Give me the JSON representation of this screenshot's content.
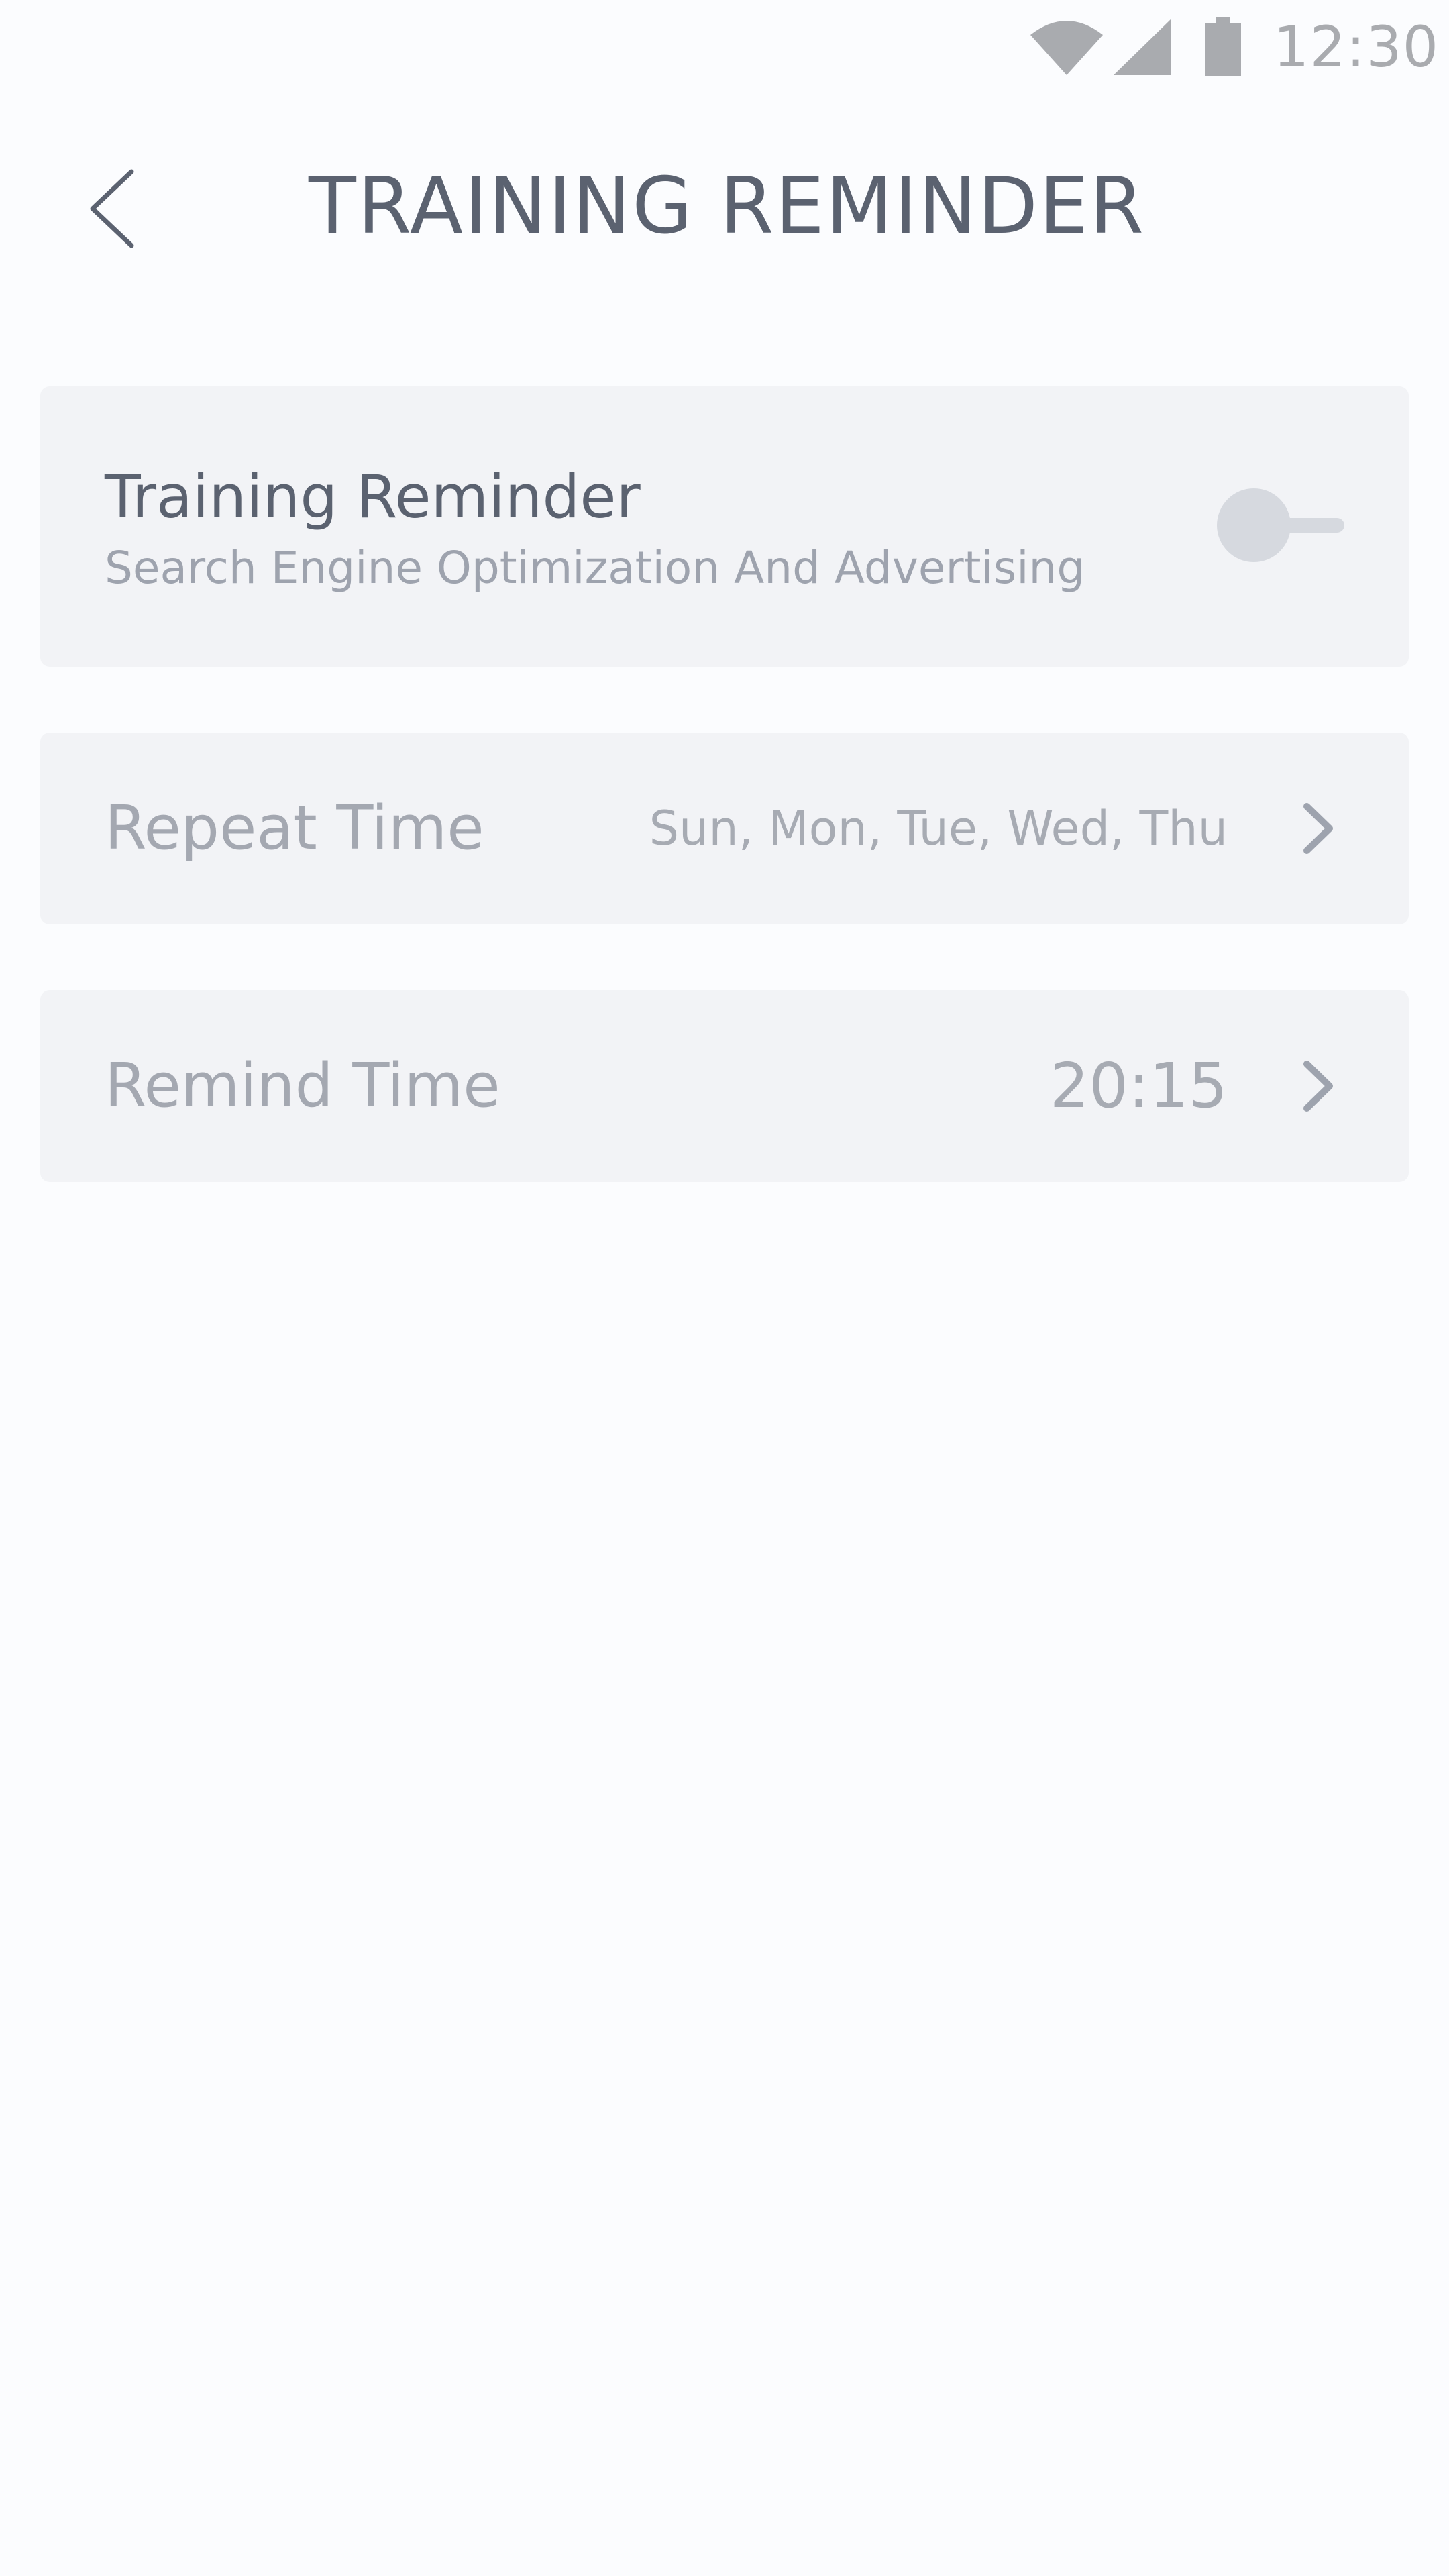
{
  "status_bar": {
    "time": "12:30",
    "icons": [
      "wifi-icon",
      "signal-icon",
      "battery-icon"
    ]
  },
  "header": {
    "title": "TRAINING REMINDER",
    "back_icon": "chevron-left-icon"
  },
  "reminder_card": {
    "title": "Training Reminder",
    "subtitle": "Search Engine Optimization And Advertising",
    "toggle_on": false
  },
  "repeat_row": {
    "label": "Repeat Time",
    "value": "Sun, Mon, Tue, Wed, Thu",
    "icon": "chevron-right-icon"
  },
  "remind_row": {
    "label": "Remind Time",
    "value": "20:15",
    "icon": "chevron-right-icon"
  },
  "colors": {
    "background": "#fbfcfe",
    "card": "#f2f3f6",
    "title_text": "#5b6270",
    "muted_text": "#a4a8b1",
    "status_icons": "#a9abaf",
    "toggle": "#d6d9df"
  }
}
